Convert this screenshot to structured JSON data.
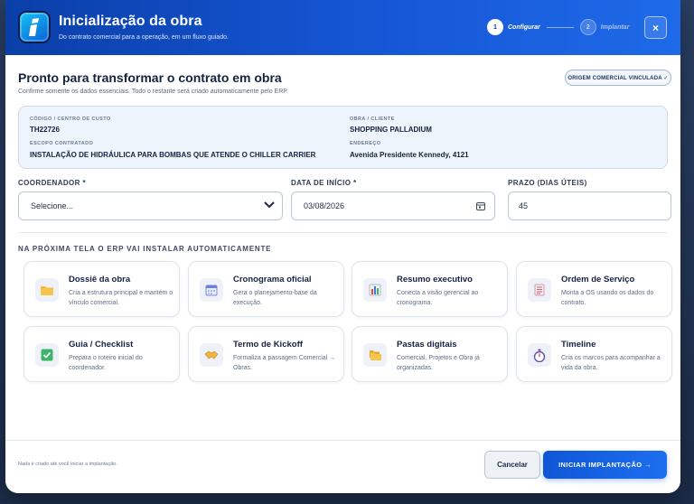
{
  "header": {
    "title": "Inicialização da obra",
    "subtitle": "Do contrato comercial para a operação, em um fluxo guiado.",
    "steps": [
      {
        "number": "1",
        "label": "Configurar"
      },
      {
        "number": "2",
        "label": "Implantar"
      }
    ],
    "close_label": "×"
  },
  "main": {
    "title": "Pronto para transformar o contrato em obra",
    "subtitle": "Confirme somente os dados essenciais. Todo o restante será criado automaticamente pelo ERP.",
    "origin_badge": "ORIGEM COMERCIAL VINCULADA ✓",
    "info": {
      "cost_center_label": "CÓDIGO / CENTRO DE CUSTO",
      "cost_center_value": "TH22726",
      "client_label": "OBRA / CLIENTE",
      "client_value": "SHOPPING PALLADIUM",
      "scope_label": "ESCOPO CONTRATADO",
      "scope_value": "INSTALAÇÃO DE HIDRÁULICA PARA BOMBAS QUE ATENDE O CHILLER CARRIER",
      "address_label": "ENDEREÇO",
      "address_value": "Avenida Presidente Kennedy, 4121"
    },
    "form": {
      "coordinator_label": "COORDENADOR *",
      "coordinator_value": "Selecione...",
      "start_date_label": "DATA DE INÍCIO *",
      "start_date_value": "03/08/2026",
      "deadline_label": "PRAZO (DIAS ÚTEIS)",
      "deadline_value": "45"
    },
    "auto_title": "NA PRÓXIMA TELA O ERP VAI INSTALAR AUTOMATICAMENTE",
    "cards": [
      {
        "title": "Dossiê da obra",
        "desc": "Cria a estrutura principal e mantém o vínculo comercial.",
        "icon": "folder-icon"
      },
      {
        "title": "Cronograma oficial",
        "desc": "Gera o planejamento-base da execução.",
        "icon": "calendar-icon"
      },
      {
        "title": "Resumo executivo",
        "desc": "Conecta a visão gerencial ao cronograma.",
        "icon": "bar-chart-icon"
      },
      {
        "title": "Ordem de Serviço",
        "desc": "Monta a OS usando os dados do contrato.",
        "icon": "document-icon"
      },
      {
        "title": "Guia / Checklist",
        "desc": "Prepara o roteiro inicial do coordenador.",
        "icon": "checkbox-icon"
      },
      {
        "title": "Termo de Kickoff",
        "desc": "Formaliza a passagem Comercial → Obras.",
        "icon": "handshake-icon"
      },
      {
        "title": "Pastas digitais",
        "desc": "Comercial, Projetos e Obra já organizadas.",
        "icon": "folders-icon"
      },
      {
        "title": "Timeline",
        "desc": "Cria os marcos para acompanhar a vida da obra.",
        "icon": "stopwatch-icon"
      }
    ]
  },
  "footer": {
    "note": "Nada é criado até você iniciar a implantação.",
    "cancel_label": "Cancelar",
    "primary_label": "INICIAR IMPLANTAÇÃO →"
  }
}
